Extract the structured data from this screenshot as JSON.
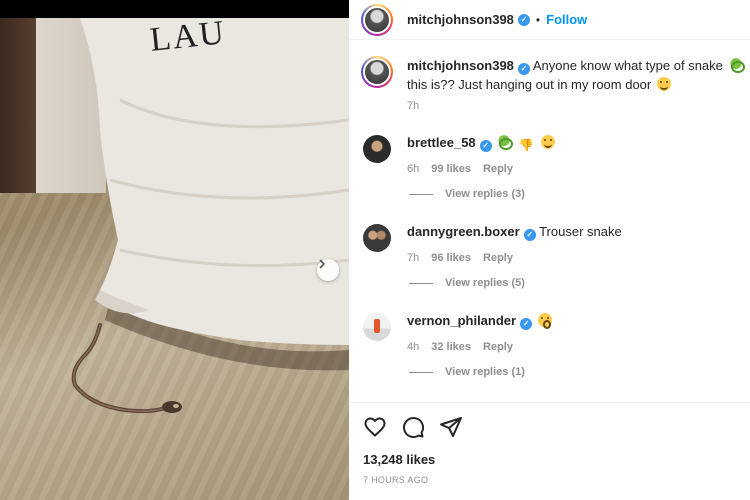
{
  "post": {
    "author": "mitchjohnson398",
    "follow_label": "Follow",
    "separator": "•",
    "photo_text": "LAU",
    "caption_text": "Anyone know what type of snake",
    "caption_text_2": "this is?? Just hanging out in my room door",
    "caption_time": "7h",
    "likes": "13,248 likes",
    "posted_ago": "7 HOURS AGO"
  },
  "comments": [
    {
      "username": "brettlee_58",
      "text": "",
      "time": "6h",
      "likes": "99 likes",
      "reply_label": "Reply",
      "view_replies": "View replies (3)",
      "emojis": [
        "snake-emoji",
        "thumbs-down-emoji",
        "laughing-emoji"
      ]
    },
    {
      "username": "dannygreen.boxer",
      "text": "Trouser snake",
      "time": "7h",
      "likes": "96 likes",
      "reply_label": "Reply",
      "view_replies": "View replies (5)"
    },
    {
      "username": "vernon_philander",
      "text": "",
      "time": "4h",
      "likes": "32 likes",
      "reply_label": "Reply",
      "view_replies": "View replies (1)",
      "emojis": [
        "surprised-emoji"
      ]
    }
  ],
  "icons": {
    "like": "heart-icon",
    "comment": "comment-icon",
    "share": "paper-plane-icon",
    "next": "chevron-right-icon",
    "verified": "verified-badge-icon"
  },
  "colors": {
    "accent": "#0095f6",
    "verified": "#3897f0",
    "muted": "#8e8e8e",
    "text": "#262626"
  }
}
